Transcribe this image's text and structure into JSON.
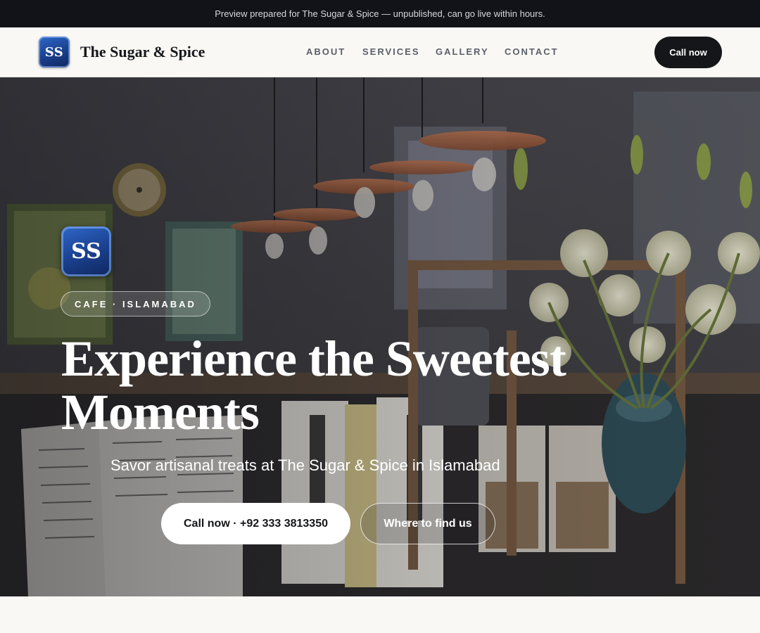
{
  "announcement": {
    "text": "Preview prepared for The Sugar & Spice — unpublished, can go live within hours."
  },
  "header": {
    "logo_initials": "SS",
    "brand_name": "The Sugar & Spice",
    "nav": [
      "ABOUT",
      "SERVICES",
      "GALLERY",
      "CONTACT"
    ],
    "cta_label": "Call now"
  },
  "hero": {
    "badge_initials": "SS",
    "tag": "CAFE · ISLAMABAD",
    "title": "Experience the Sweetest Moments",
    "subtitle": "Savor artisanal treats at The Sugar & Spice in Islamabad",
    "primary_button": "Call now · +92 333 3813350",
    "secondary_button": "Where to find us",
    "background_image": "cafe-interior-photo"
  },
  "colors": {
    "dark": "#15161a",
    "page_bg": "#f9f8f5",
    "logo_blue": "#1a3f8c",
    "nav_text": "#5b5f68"
  }
}
